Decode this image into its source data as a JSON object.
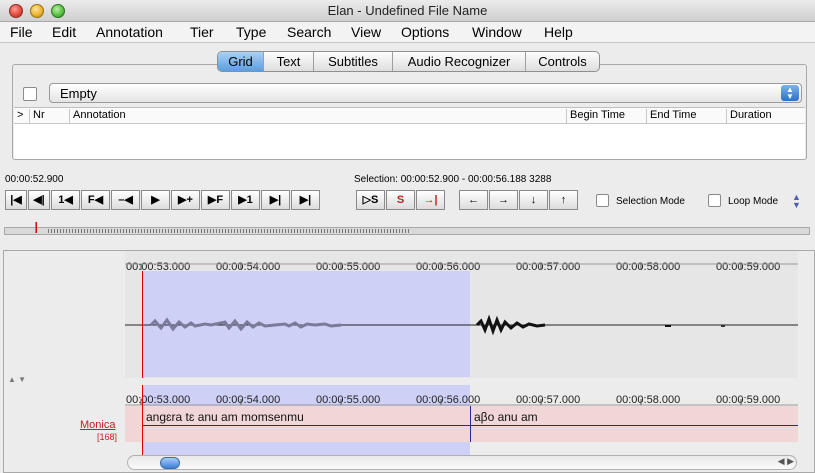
{
  "window": {
    "title": "Elan - Undefined File Name"
  },
  "menu": [
    "File",
    "Edit",
    "Annotation",
    "Tier",
    "Type",
    "Search",
    "View",
    "Options",
    "Window",
    "Help"
  ],
  "tabs": {
    "items": [
      "Grid",
      "Text",
      "Subtitles",
      "Audio Recognizer",
      "Controls"
    ],
    "active": "Grid"
  },
  "grid": {
    "tier_select_value": "Empty",
    "columns": [
      ">",
      "Nr",
      "Annotation",
      "Begin Time",
      "End Time",
      "Duration"
    ]
  },
  "media": {
    "current_time": "00:00:52.900",
    "selection_text": "Selection: 00:00:52.900 - 00:00:56.188  3288",
    "selection_mode_label": "Selection Mode",
    "loop_mode_label": "Loop Mode",
    "buttons": {
      "go_to_begin": "|◀",
      "prev_scroll": "◀|",
      "prev_second": "1◀",
      "prev_frame": "F◀",
      "prev_pixel": "–◀",
      "play": "▶",
      "next_pixel": "▶+",
      "next_frame": "▶F",
      "next_second": "▶1",
      "next_scroll": "▶|",
      "go_to_end": "▶|",
      "play_selection": "▷S",
      "clear_selection": "S",
      "to_selection_end": "→|",
      "arrow_left": "←",
      "arrow_right": "→",
      "arrow_down": "↓",
      "arrow_up": "↑"
    }
  },
  "timeline": {
    "ruler_labels": [
      "00:00:53.000",
      "00:00:54.000",
      "00:00:55.000",
      "00:00:56.000",
      "00:00:57.000",
      "00:00:58.000",
      "00:00:59.000"
    ],
    "tier": {
      "name": "Monica",
      "count": "[168]"
    },
    "annotations": [
      "angɛra tɛ anu am momsenmu",
      "aβo anu am"
    ]
  },
  "colors": {
    "selection": "#cfd0f6",
    "tier_background": "#f0d6d6",
    "cursor": "#dd0000",
    "tier_name": "#c02020"
  }
}
